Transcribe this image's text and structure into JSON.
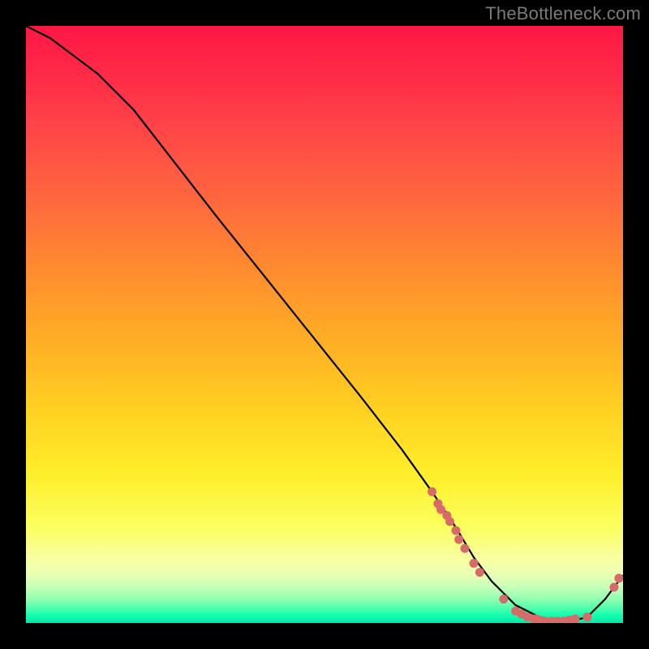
{
  "watermark": "TheBottleneck.com",
  "chart_data": {
    "type": "line",
    "title": "",
    "xlabel": "",
    "ylabel": "",
    "xlim": [
      0,
      100
    ],
    "ylim": [
      0,
      100
    ],
    "series": [
      {
        "name": "curve",
        "x": [
          0,
          4,
          8,
          12,
          18,
          25,
          32,
          40,
          48,
          56,
          63,
          68,
          72,
          75,
          78,
          82,
          86,
          90,
          94,
          97,
          100
        ],
        "y": [
          100,
          98,
          95,
          92,
          86,
          77,
          68,
          58,
          48,
          38,
          29,
          22,
          16,
          11,
          7,
          3,
          1,
          0,
          1,
          4,
          8
        ]
      }
    ],
    "points": [
      {
        "x": 68,
        "y": 22
      },
      {
        "x": 69,
        "y": 20
      },
      {
        "x": 69.5,
        "y": 19
      },
      {
        "x": 70.5,
        "y": 18
      },
      {
        "x": 71,
        "y": 17
      },
      {
        "x": 72,
        "y": 15.5
      },
      {
        "x": 72.5,
        "y": 14
      },
      {
        "x": 73.5,
        "y": 12.5
      },
      {
        "x": 75,
        "y": 10
      },
      {
        "x": 76,
        "y": 8.5
      },
      {
        "x": 80,
        "y": 4
      },
      {
        "x": 82,
        "y": 2
      },
      {
        "x": 83,
        "y": 1.5
      },
      {
        "x": 84,
        "y": 1
      },
      {
        "x": 85,
        "y": 0.7
      },
      {
        "x": 85.5,
        "y": 0.7
      },
      {
        "x": 86,
        "y": 0.5
      },
      {
        "x": 87,
        "y": 0.3
      },
      {
        "x": 88,
        "y": 0.3
      },
      {
        "x": 89,
        "y": 0.3
      },
      {
        "x": 90,
        "y": 0.3
      },
      {
        "x": 91,
        "y": 0.5
      },
      {
        "x": 92,
        "y": 0.7
      },
      {
        "x": 94,
        "y": 1
      },
      {
        "x": 98.5,
        "y": 6
      },
      {
        "x": 99.3,
        "y": 7.5
      }
    ],
    "point_color": "#d86a6a",
    "line_color": "#000000"
  }
}
